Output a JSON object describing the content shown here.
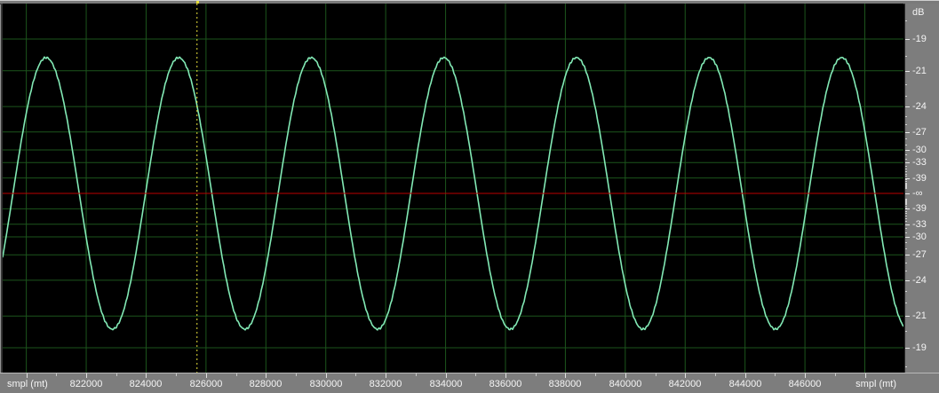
{
  "colors": {
    "background": "#000000",
    "grid_green": "#1c551c",
    "waveform_green": "#82e9b5",
    "zero_line_red": "#bc0000",
    "cursor_yellow": "#e8df3a",
    "ruler_background": "#7d7d7d",
    "ruler_text": "#f4f4f4",
    "tick_white": "#e8e8e8"
  },
  "rulers": {
    "level": {
      "unit": "dB",
      "major_db_values": [
        19,
        21,
        24,
        27,
        30,
        33,
        39
      ],
      "major_labels": [
        "-19",
        "-21",
        "-24",
        "-27",
        "-30",
        "-33",
        "-39"
      ],
      "center_label": "-∞",
      "minor_db_from": 18,
      "minor_db_to": 48
    },
    "time": {
      "unit_left": "smpl (mt)",
      "unit_right": "smpl (mt)",
      "first_major_sample": 820000,
      "last_major_sample": 848000,
      "major_step": 2000,
      "minor_step": 1000,
      "labeled_samples": [
        822000,
        824000,
        826000,
        828000,
        830000,
        832000,
        834000,
        836000,
        838000,
        840000,
        842000,
        844000,
        846000
      ]
    }
  },
  "cursor": {
    "sample": 825700,
    "style": "dotted-vertical-line",
    "color": "#e8df3a"
  },
  "chart_data": {
    "type": "line",
    "subtype": "audio-waveform-oscilloscope-view",
    "title": "",
    "x_unit": "smpl (mt)",
    "x_visible_range": [
      819210,
      849290
    ],
    "x_tick_labels": [
      "822000",
      "824000",
      "826000",
      "828000",
      "830000",
      "832000",
      "834000",
      "836000",
      "838000",
      "840000",
      "842000",
      "844000",
      "846000"
    ],
    "y_ruler_unit": "dB",
    "y_tick_labels_top_to_bottom": [
      "-19",
      "-21",
      "-24",
      "-27",
      "-30",
      "-33",
      "-39",
      "-∞",
      "-39",
      "-33",
      "-30",
      "-27",
      "-24",
      "-21",
      "-19"
    ],
    "y_scale": "linear amplitude, dB-calibrated ruler, -∞ at center",
    "grid": true,
    "legend": false,
    "zero_line_db": "-∞",
    "series": [
      {
        "name": "audio-waveform",
        "shape": "sine",
        "color": "#82e9b5",
        "peak_level_db": -20.1,
        "peak_amplitude_linear": 0.0987,
        "period_samples": 4428,
        "first_visible_peak_sample": 820660,
        "visible_peak_samples": [
          820660,
          825088,
          829516,
          833944,
          838372,
          842800,
          847228
        ],
        "noise": "slight sample jitter at extremes"
      }
    ]
  }
}
